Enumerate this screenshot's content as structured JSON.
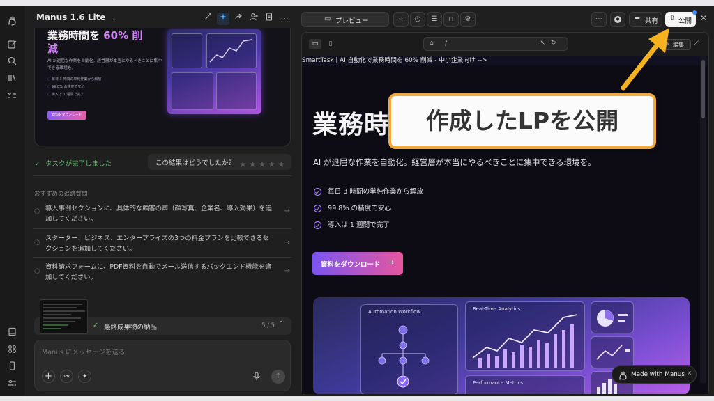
{
  "header": {
    "app_title": "Manus 1.6 Lite",
    "preview_tab": "プレビュー",
    "share_label": "共有",
    "publish_label": "公開"
  },
  "thumbnail": {
    "hero_line1a": "業務時間を ",
    "hero_line1b": "60% 削",
    "hero_line2": "減",
    "desc": "AI が退屈な作業を自動化。経営層が本当にやるべきことに集中できる環境を。",
    "features": [
      "毎日 3 時間の単純作業から解放",
      "99.8% の精度で安心",
      "導入は 1 週間で完了"
    ],
    "cta": "資料をダウンロード"
  },
  "task": {
    "complete_label": "タスクが完了しました",
    "rating_prompt": "この結果はどうでしたか？"
  },
  "suggestions": {
    "heading": "おすすめの追跡質問",
    "items": [
      "導入事例セクションに、具体的な顧客の声（顔写真、企業名、導入効果）を追加してください。",
      "スターター、ビジネス、エンタープライズの3つの料金プランを比較できるセクションを追加してください。",
      "資料請求フォームに、PDF資料を自動でメール送信するバックエンド機能を追加してください。"
    ]
  },
  "deliverable": {
    "label": "最終成果物の納品",
    "count": "5 / 5"
  },
  "composer": {
    "placeholder": "Manus にメッセージを送る"
  },
  "preview": {
    "url": "/",
    "edit_label": "編集",
    "page_comment": "SmartTask | AI 自動化で業務時間を 60% 削減 - 中小企業向け -->",
    "hero_title": "業務時",
    "subtitle": "AI が退屈な作業を自動化。経営層が本当にやるべきことに集中できる環境を。",
    "features": [
      "毎日 3 時間の単純作業から解放",
      "99.8% の精度で安心",
      "導入は 1 週間で完了"
    ],
    "cta": "資料をダウンロード",
    "card_automation": "Automation Workflow",
    "card_analytics": "Real-Time Analytics",
    "card_performance": "Performance Metrics",
    "made_with": "Made with Manus"
  },
  "annotation": {
    "callout": "作成したLPを公開"
  },
  "colors": {
    "accent_purple": "#b08cff",
    "pink": "#e95fa8",
    "callout_border": "#f2a93b",
    "arrow": "#f5b21f",
    "complete_green": "#5fbf6a"
  }
}
